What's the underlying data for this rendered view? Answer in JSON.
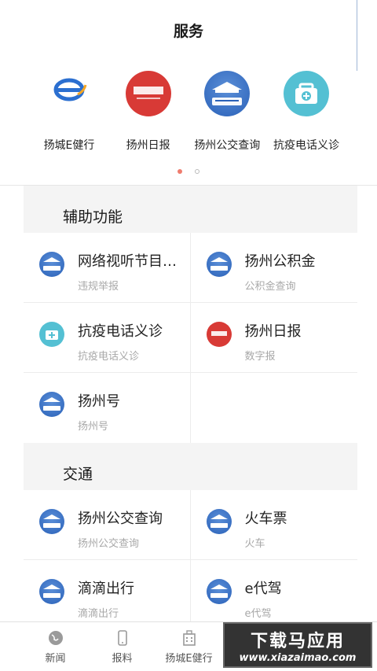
{
  "header": {
    "title": "服务"
  },
  "featured": [
    {
      "label": "扬城E健行",
      "icon": "e-jianxing-logo-icon",
      "mark": "E健行"
    },
    {
      "label": "扬州日报",
      "icon": "yangzhou-daily-logo-icon",
      "mark": "扬州日报"
    },
    {
      "label": "扬州公交查询",
      "icon": "yangzhou-release-logo-icon",
      "mark": "扬州发布"
    },
    {
      "label": "抗疫电话义诊",
      "icon": "medical-kit-icon",
      "mark": ""
    }
  ],
  "pager": {
    "active": 0,
    "count": 2
  },
  "sections": [
    {
      "title": "辅助功能",
      "items": [
        {
          "name": "网络视听节目…",
          "sub": "违规举报",
          "icon": "yangzhou-release-logo-icon",
          "mark": "扬州发布"
        },
        {
          "name": "扬州公积金",
          "sub": "公积金查询",
          "icon": "yangzhou-release-logo-icon",
          "mark": "扬州发布"
        },
        {
          "name": "抗疫电话义诊",
          "sub": "抗疫电话义诊",
          "icon": "medical-kit-icon",
          "mark": ""
        },
        {
          "name": "扬州日报",
          "sub": "数字报",
          "icon": "yangzhou-daily-logo-icon",
          "mark": "扬州日报"
        },
        {
          "name": "扬州号",
          "sub": "扬州号",
          "icon": "yangzhou-release-logo-icon",
          "mark": "扬州发布"
        }
      ]
    },
    {
      "title": "交通",
      "items": [
        {
          "name": "扬州公交查询",
          "sub": "扬州公交查询",
          "icon": "yangzhou-release-logo-icon",
          "mark": "扬州发布"
        },
        {
          "name": "火车票",
          "sub": "火车",
          "icon": "yangzhou-release-logo-icon",
          "mark": "扬州发布"
        },
        {
          "name": "滴滴出行",
          "sub": "滴滴出行",
          "icon": "yangzhou-release-logo-icon",
          "mark": "扬州发布"
        },
        {
          "name": "e代驾",
          "sub": "e代驾",
          "icon": "yangzhou-release-logo-icon",
          "mark": "扬州发布"
        }
      ]
    }
  ],
  "tabbar": [
    {
      "label": "新闻",
      "icon": "globe-icon"
    },
    {
      "label": "报料",
      "icon": "phone-icon"
    },
    {
      "label": "扬城E健行",
      "icon": "building-icon"
    }
  ],
  "watermark": {
    "line1": "下载马应用",
    "line2": "www.xiazaimao.com"
  }
}
